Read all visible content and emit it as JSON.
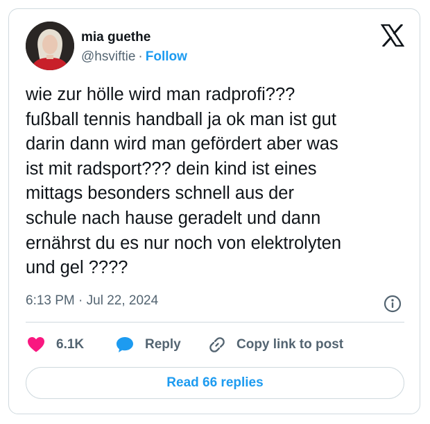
{
  "author": {
    "name": "mia guethe",
    "handle": "@hsviftie",
    "separator": "·",
    "follow_label": "Follow",
    "avatar_icon": "profile-photo"
  },
  "brand": {
    "icon": "x-logo-icon",
    "color": "#0f1419"
  },
  "tweet": {
    "text": "wie zur hölle wird man radprofi???\nfußball tennis handball ja ok man ist gut\ndarin dann wird man gefördert aber was\nist mit radsport??? dein kind ist eines\nmittags besonders schnell aus der\nschule nach hause geradelt und dann\nernährst du es nur noch von elektrolyten\nund gel ????",
    "time": "6:13 PM",
    "date_separator": "·",
    "date": "Jul 22, 2024"
  },
  "actions": {
    "like_count": "6.1K",
    "reply_label": "Reply",
    "copy_label": "Copy link to post"
  },
  "read_replies_label": "Read 66 replies",
  "colors": {
    "accent": "#1d9bf0",
    "like": "#f91880",
    "text": "#0f1419",
    "secondary": "#536471",
    "border": "#cfd9de"
  }
}
